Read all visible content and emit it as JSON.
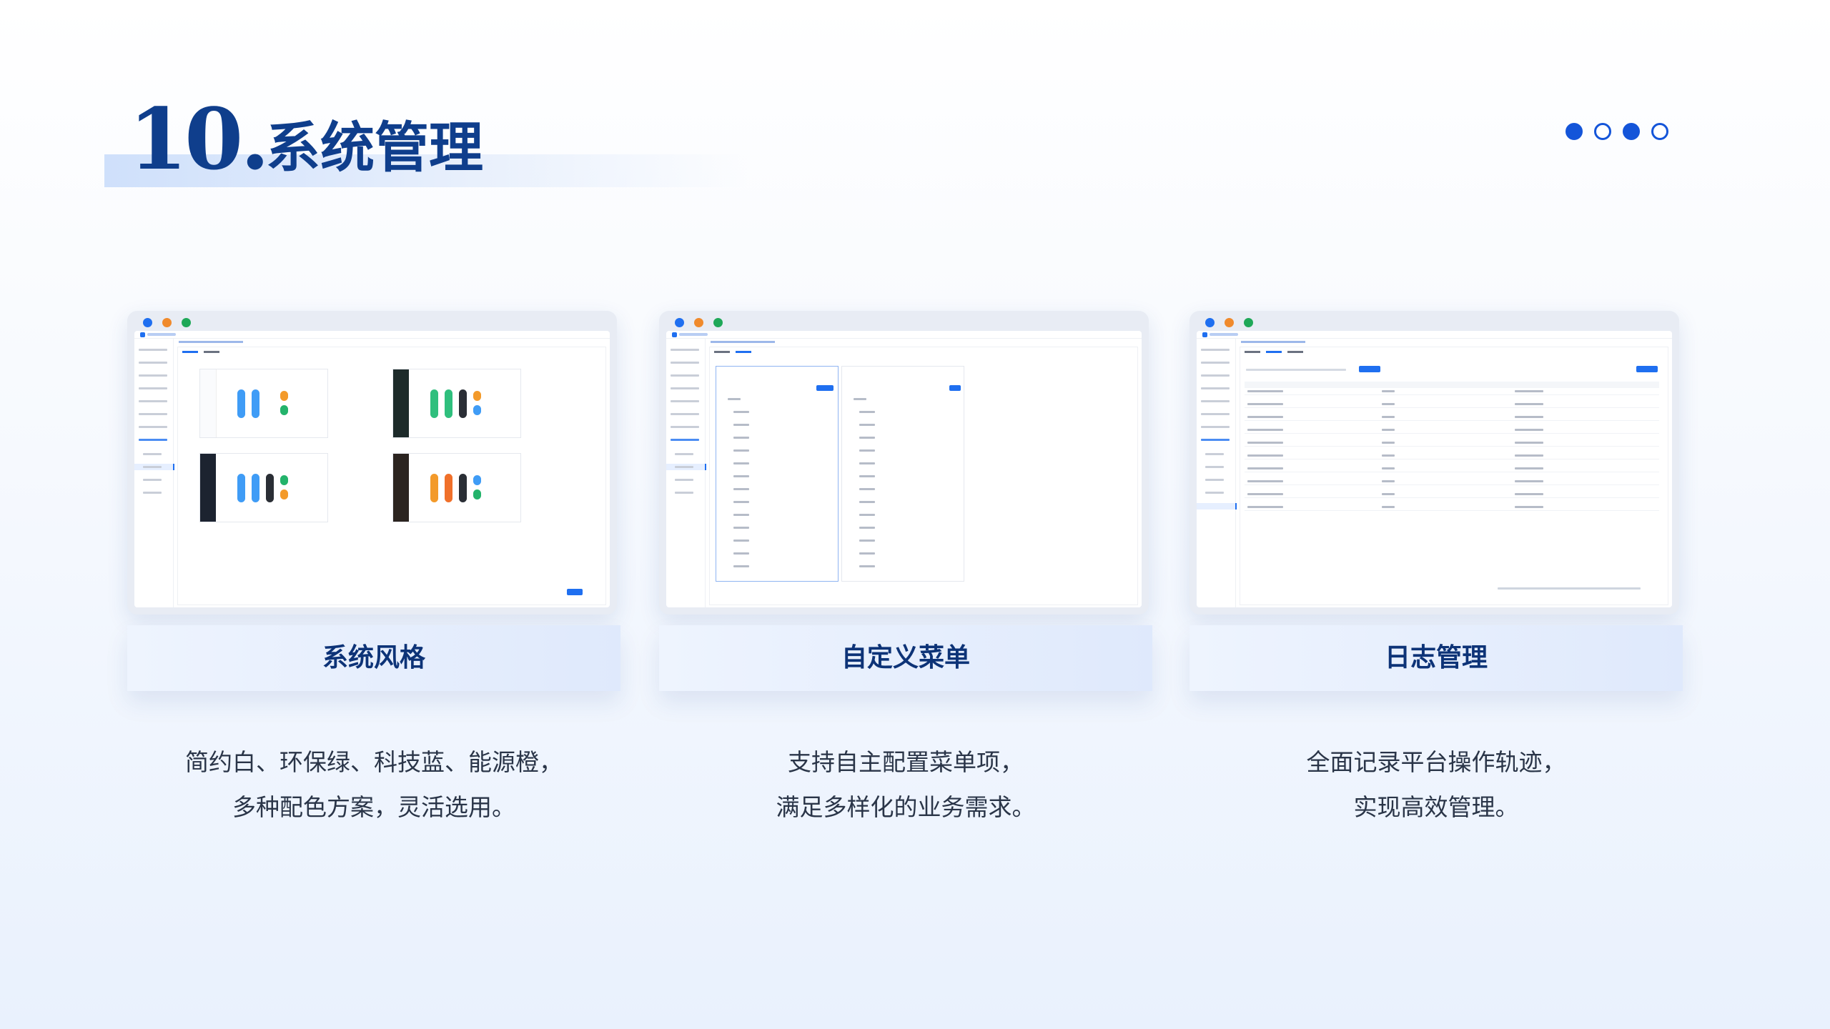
{
  "header": {
    "number": "10.",
    "title": "系统管理"
  },
  "pagination_dots": [
    "filled",
    "empty",
    "filled",
    "empty"
  ],
  "colors": {
    "title": "#0f3e8c",
    "accent": "#1455d9",
    "dot_blue": "#1f6ff0",
    "dot_orange": "#f08a2c",
    "dot_green": "#1fa858"
  },
  "cards": [
    {
      "label": "系统风格",
      "desc_line1": "简约白、环保绿、科技蓝、能源橙，",
      "desc_line2": "多种配色方案，灵活选用。"
    },
    {
      "label": "自定义菜单",
      "desc_line1": "支持自主配置菜单项，",
      "desc_line2": "满足多样化的业务需求。"
    },
    {
      "label": "日志管理",
      "desc_line1": "全面记录平台操作轨迹，",
      "desc_line2": "实现高效管理。"
    }
  ]
}
